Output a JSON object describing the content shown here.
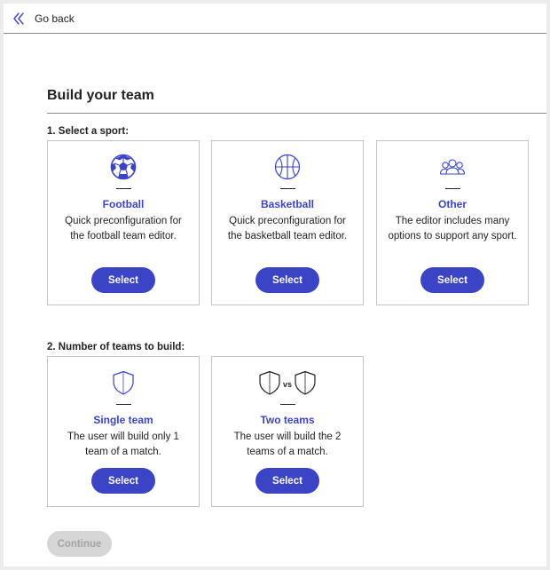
{
  "nav": {
    "back_label": "Go back",
    "back_icon": "double-chevron-left-icon"
  },
  "page": {
    "title": "Build your team"
  },
  "sport_section": {
    "label": "1. Select a sport:",
    "cards": [
      {
        "icon": "soccer-ball-icon",
        "title": "Football",
        "description": "Quick preconfiguration for the football team editor.",
        "button_label": "Select"
      },
      {
        "icon": "basketball-icon",
        "title": "Basketball",
        "description": "Quick preconfiguration for the basketball team editor.",
        "button_label": "Select"
      },
      {
        "icon": "people-group-icon",
        "title": "Other",
        "description": "The editor includes many options to support any sport.",
        "button_label": "Select"
      }
    ]
  },
  "teams_section": {
    "label": "2. Number of teams to build:",
    "cards": [
      {
        "icon": "shield-icon",
        "title": "Single team",
        "description": "The user will build only 1 team of a match.",
        "button_label": "Select"
      },
      {
        "icon": "shield-vs-shield-icon",
        "icon_text": "vs",
        "title": "Two teams",
        "description": "The user will build the 2 teams of a match.",
        "button_label": "Select"
      }
    ]
  },
  "footer": {
    "continue_label": "Continue",
    "continue_disabled": true
  },
  "colors": {
    "accent": "#3b44c5",
    "disabled_bg": "#d6d6d6",
    "disabled_text": "#a3a3a3"
  }
}
